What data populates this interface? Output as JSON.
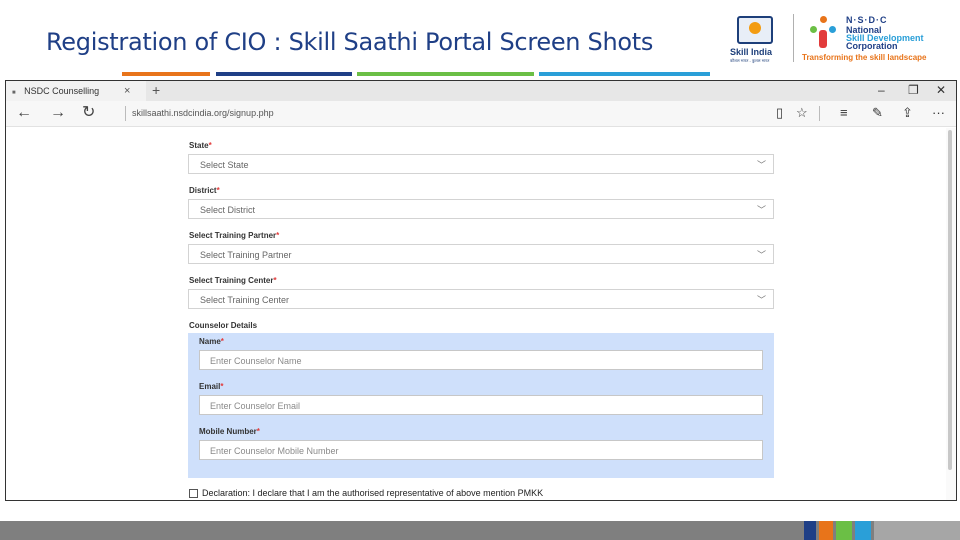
{
  "slide": {
    "title": "Registration of CIO : Skill Saathi Portal Screen Shots"
  },
  "logos": {
    "skill_india": {
      "name": "Skill India",
      "tagline": "कौशल भारत - कुशल भारत",
      "icon": "skill-india-icon"
    },
    "nsdc": {
      "brand": "N·S·D·C",
      "line1": "National",
      "line2": "Skill Development",
      "line3": "Corporation",
      "tagline": "Transforming the skill landscape",
      "icon": "nsdc-figure-icon"
    }
  },
  "colors": {
    "title": "#1f3f86",
    "bar_orange": "#e8741a",
    "bar_navy": "#1f3f86",
    "bar_green": "#6bbf45",
    "bar_blue": "#2a9fd8",
    "counselor_bg": "#cfe0fb",
    "required": "#e23b3b"
  },
  "browser": {
    "tab_label": "NSDC Counselling",
    "address": "skillsaathi.nsdcindia.org/signup.php",
    "icons": {
      "back": "back-arrow-icon",
      "forward": "forward-arrow-icon",
      "refresh": "refresh-icon",
      "lock": "lock-icon",
      "reading": "reading-view-icon",
      "favorite": "star-icon",
      "hub": "hub-icon",
      "note": "web-note-icon",
      "share": "share-icon",
      "more": "more-icon"
    }
  },
  "form": {
    "state": {
      "label": "State",
      "placeholder": "Select State"
    },
    "district": {
      "label": "District",
      "placeholder": "Select District"
    },
    "training_partner": {
      "label": "Select Training Partner",
      "placeholder": "Select Training Partner"
    },
    "training_center": {
      "label": "Select Training Center",
      "placeholder": "Select Training Center"
    },
    "counselor_heading": "Counselor Details",
    "name": {
      "label": "Name",
      "placeholder": "Enter Counselor Name"
    },
    "email": {
      "label": "Email",
      "placeholder": "Enter Counselor Email"
    },
    "mobile": {
      "label": "Mobile Number",
      "placeholder": "Enter Counselor Mobile Number"
    },
    "required_mark": "*",
    "declaration": "Declaration: I declare that I am the authorised representative of above mention PMKK"
  }
}
